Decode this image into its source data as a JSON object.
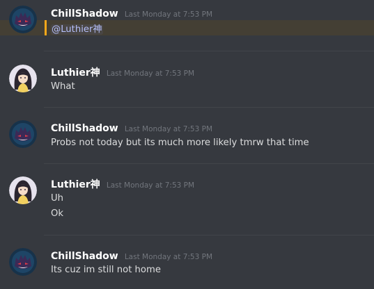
{
  "messages": [
    {
      "author": "ChillShadow",
      "timestamp": "Last Monday at 7:53 PM",
      "avatar": "gengar-icon",
      "lines": [
        "@Luthier神"
      ],
      "mention": true
    },
    {
      "author": "Luthier神",
      "timestamp": "Last Monday at 7:53 PM",
      "avatar": "anime-girl-icon",
      "lines": [
        "What"
      ]
    },
    {
      "author": "ChillShadow",
      "timestamp": "Last Monday at 7:53 PM",
      "avatar": "gengar-icon",
      "lines": [
        "Probs not today but its much more likely tmrw that time"
      ]
    },
    {
      "author": "Luthier神",
      "timestamp": "Last Monday at 7:53 PM",
      "avatar": "anime-girl-icon",
      "lines": [
        "Uh",
        "Ok"
      ]
    },
    {
      "author": "ChillShadow",
      "timestamp": "Last Monday at 7:53 PM",
      "avatar": "gengar-icon",
      "lines": [
        "Its cuz im still not home"
      ]
    }
  ],
  "colors": {
    "background": "#36393f",
    "username": "#ffffff",
    "timestamp": "#72767d",
    "text": "#dcddde",
    "mention_highlight": "#443f34",
    "mention_edge": "#faa81a",
    "mention_text": "#b5bffa"
  }
}
